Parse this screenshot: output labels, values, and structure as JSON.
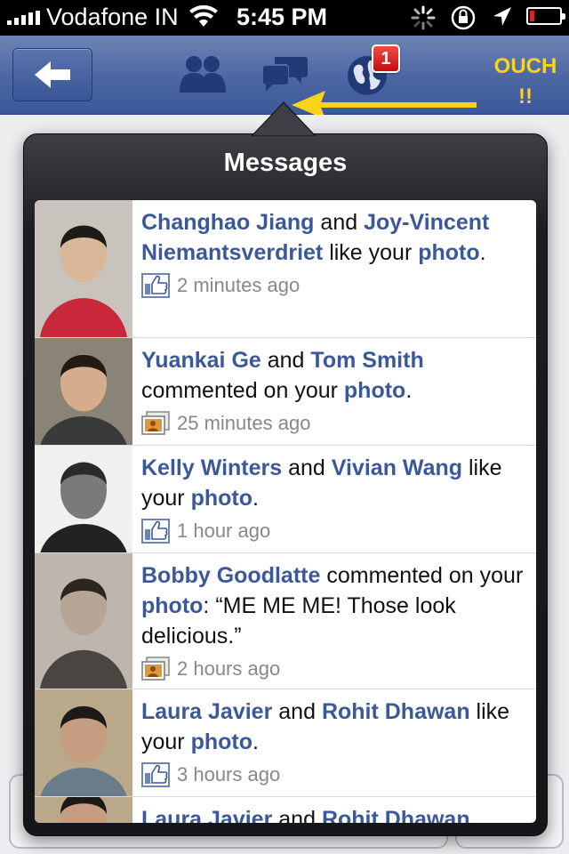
{
  "status_bar": {
    "carrier": "Vodafone IN",
    "time": "5:45 PM"
  },
  "nav": {
    "back_icon": "back-arrow-icon",
    "friends_icon": "friends-icon",
    "messages_icon": "messages-icon",
    "notifications_icon": "globe-icon",
    "notification_count": "1",
    "annotation_line1": "OUCH",
    "annotation_line2": "!!",
    "annotation_color": "#ffd21a"
  },
  "popover": {
    "title": "Messages",
    "notifications": [
      {
        "parts": [
          {
            "text": "Changhao Jiang",
            "link": true
          },
          {
            "text": " and ",
            "link": false
          },
          {
            "text": "Joy-Vincent Niemantsverdriet",
            "link": true
          },
          {
            "text": " like your ",
            "link": false
          },
          {
            "text": "photo",
            "link": true
          },
          {
            "text": ".",
            "link": false
          }
        ],
        "icon": "like-icon",
        "time": "2 minutes ago"
      },
      {
        "parts": [
          {
            "text": "Yuankai Ge",
            "link": true
          },
          {
            "text": " and ",
            "link": false
          },
          {
            "text": "Tom Smith",
            "link": true
          },
          {
            "text": " commented on your ",
            "link": false
          },
          {
            "text": "photo",
            "link": true
          },
          {
            "text": ".",
            "link": false
          }
        ],
        "icon": "comment-photo-icon",
        "time": "25 minutes ago"
      },
      {
        "parts": [
          {
            "text": "Kelly Winters",
            "link": true
          },
          {
            "text": " and ",
            "link": false
          },
          {
            "text": "Vivian Wang",
            "link": true
          },
          {
            "text": " like your ",
            "link": false
          },
          {
            "text": "photo",
            "link": true
          },
          {
            "text": ".",
            "link": false
          }
        ],
        "icon": "like-icon",
        "time": "1 hour ago"
      },
      {
        "parts": [
          {
            "text": "Bobby Goodlatte",
            "link": true
          },
          {
            "text": " commented on your ",
            "link": false
          },
          {
            "text": "photo",
            "link": true
          },
          {
            "text": ": “ME ME ME! Those look delicious.”",
            "link": false
          }
        ],
        "icon": "comment-photo-icon",
        "time": "2 hours ago"
      },
      {
        "parts": [
          {
            "text": "Laura Javier",
            "link": true
          },
          {
            "text": " and ",
            "link": false
          },
          {
            "text": "Rohit Dhawan",
            "link": true
          },
          {
            "text": " like your ",
            "link": false
          },
          {
            "text": "photo",
            "link": true
          },
          {
            "text": ".",
            "link": false
          }
        ],
        "icon": "like-icon",
        "time": "3 hours ago"
      },
      {
        "parts": [
          {
            "text": "Laura Javier",
            "link": true
          },
          {
            "text": " and ",
            "link": false
          },
          {
            "text": "Rohit Dhawan",
            "link": true
          }
        ],
        "icon": "like-icon",
        "time": ""
      }
    ]
  },
  "colors": {
    "facebook_blue": "#3b5998",
    "navbar": "#4c66a4",
    "badge_red": "#d8161a"
  }
}
